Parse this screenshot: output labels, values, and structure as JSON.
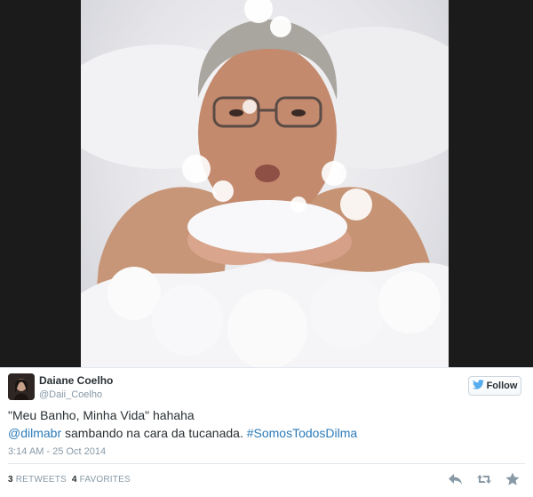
{
  "tweet": {
    "author_name": "Daiane Coelho",
    "handle": "@Daii_Coelho",
    "follow_label": "Follow",
    "text_line1": "\"Meu Banho, Minha Vida\" hahaha",
    "mention": "@dilmabr",
    "text_line2_mid": " sambando na cara da tucanada. ",
    "hashtag": "#SomosTodosDilma",
    "timestamp": "3:14 AM - 25 Oct 2014",
    "retweets_count": "3",
    "retweets_label": "RETWEETS",
    "favorites_count": "4",
    "favorites_label": "FAVORITES"
  },
  "icons": {
    "follow": "bird-icon",
    "reply": "reply-icon",
    "retweet": "retweet-icon",
    "favorite": "star-icon"
  },
  "colors": {
    "link": "#2b7bb9",
    "muted": "#8899a6",
    "text": "#292f33",
    "bird": "#55acee"
  }
}
